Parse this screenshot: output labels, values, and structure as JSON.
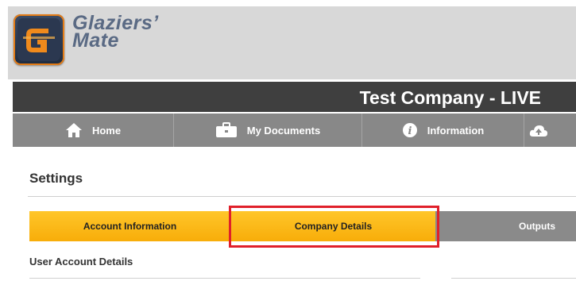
{
  "brand": {
    "line1": "Glaziers’",
    "line2": "Mate"
  },
  "header": {
    "company_title": "Test Company - LIVE"
  },
  "nav": {
    "items": [
      {
        "label": "Home",
        "icon": "home-icon"
      },
      {
        "label": "My Documents",
        "icon": "briefcase-icon"
      },
      {
        "label": "Information",
        "icon": "info-icon"
      },
      {
        "label": "",
        "icon": "cloud-upload-icon"
      }
    ]
  },
  "settings": {
    "title": "Settings",
    "tabs": [
      {
        "label": "Account Information",
        "color": "#f8b80f"
      },
      {
        "label": "Company Details",
        "color": "#f8b80f",
        "selected": true
      },
      {
        "label": "Outputs",
        "color": "#8a8a8a"
      }
    ],
    "section_title": "User Account Details"
  },
  "colors": {
    "title_bar": "#3f3f3f",
    "nav_bar": "#888888",
    "tab_orange": "#f8b80f",
    "highlight": "#e0202a"
  }
}
